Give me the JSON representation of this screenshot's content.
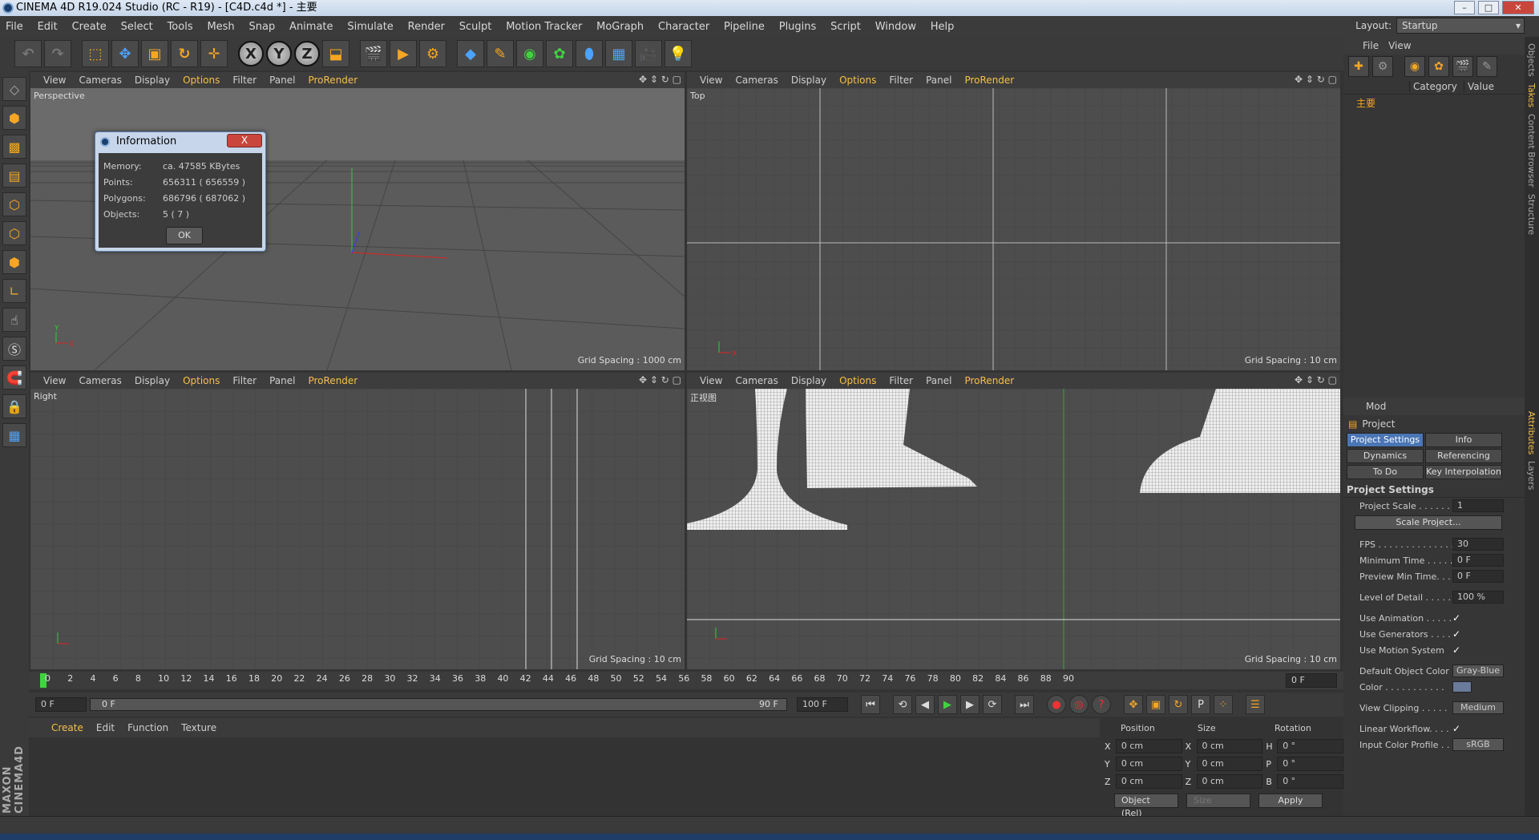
{
  "window": {
    "title": "CINEMA 4D R19.024 Studio (RC - R19) - [C4D.c4d *] - 主要"
  },
  "menu": [
    "File",
    "Edit",
    "Create",
    "Select",
    "Tools",
    "Mesh",
    "Snap",
    "Animate",
    "Simulate",
    "Render",
    "Sculpt",
    "Motion Tracker",
    "MoGraph",
    "Character",
    "Pipeline",
    "Plugins",
    "Script",
    "Window",
    "Help"
  ],
  "layout": {
    "label": "Layout:",
    "value": "Startup"
  },
  "viewport_menu": [
    "View",
    "Cameras",
    "Display",
    "Options",
    "Filter",
    "Panel",
    "ProRender"
  ],
  "viewports": [
    {
      "name": "Perspective",
      "grid": "Grid Spacing : 1000 cm"
    },
    {
      "name": "Top",
      "grid": "Grid Spacing : 10 cm"
    },
    {
      "name": "Right",
      "grid": "Grid Spacing : 10 cm"
    },
    {
      "name": "正视图",
      "grid": "Grid Spacing : 10 cm"
    }
  ],
  "info_dialog": {
    "title": "Information",
    "close": "X",
    "rows": [
      {
        "k": "Memory:",
        "v": "ca. 47585 KBytes"
      },
      {
        "k": "Points:",
        "v": "656311 ( 656559 )"
      },
      {
        "k": "Polygons:",
        "v": "686796 ( 687062 )"
      },
      {
        "k": "Objects:",
        "v": "5 ( 7 )"
      }
    ],
    "ok": "OK"
  },
  "timeline": {
    "ticks": [
      "0",
      "2",
      "4",
      "6",
      "8",
      "10",
      "12",
      "14",
      "16",
      "18",
      "20",
      "22",
      "24",
      "26",
      "28",
      "30",
      "32",
      "34",
      "36",
      "38",
      "40",
      "42",
      "44",
      "46",
      "48",
      "50",
      "52",
      "54",
      "56",
      "58",
      "60",
      "62",
      "64",
      "66",
      "68",
      "70",
      "72",
      "74",
      "76",
      "78",
      "80",
      "82",
      "84",
      "86",
      "88",
      "90"
    ],
    "current_frame": "0 F"
  },
  "transport": {
    "start": "0 F",
    "range_start": "0 F",
    "range_end": "90 F",
    "end": "100 F"
  },
  "material_manager": {
    "menu": [
      "Create",
      "Edit",
      "Function",
      "Texture"
    ]
  },
  "coords": {
    "headers": [
      "Position",
      "Size",
      "Rotation"
    ],
    "rows": [
      {
        "a": "X",
        "p": "0 cm",
        "b": "X",
        "s": "0 cm",
        "c": "H",
        "r": "0 °"
      },
      {
        "a": "Y",
        "p": "0 cm",
        "b": "Y",
        "s": "0 cm",
        "c": "P",
        "r": "0 °"
      },
      {
        "a": "Z",
        "p": "0 cm",
        "b": "Z",
        "s": "0 cm",
        "c": "B",
        "r": "0 °"
      }
    ],
    "mode": "Object (Rel)",
    "size_mode": "Size",
    "apply": "Apply"
  },
  "object_manager": {
    "menu": [
      "File",
      "View"
    ],
    "columns": [
      "Category",
      "Value"
    ],
    "tree_item": "主要"
  },
  "attributes": {
    "mode": "Mod",
    "title": "Project",
    "tabs": [
      "Project Settings",
      "Info",
      "Dynamics",
      "Referencing",
      "To Do",
      "Key Interpolation"
    ],
    "section": "Project Settings",
    "project_scale": {
      "label": "Project Scale . . . . . .",
      "value": "1"
    },
    "scale_button": "Scale Project...",
    "fps": {
      "label": "FPS . . . . . . . . . . . . . . .",
      "value": "30"
    },
    "min_time": {
      "label": "Minimum Time . . . . .",
      "value": "0 F"
    },
    "preview_min": {
      "label": "Preview Min Time. . .",
      "value": "0 F"
    },
    "lod": {
      "label": "Level of Detail . . . . .",
      "value": "100 %"
    },
    "use_animation": {
      "label": "Use Animation . . . . .",
      "value": "✓"
    },
    "use_generators": {
      "label": "Use Generators . . . .",
      "value": "✓"
    },
    "use_motion": {
      "label": "Use Motion System",
      "value": "✓"
    },
    "default_color": {
      "label": "Default Object Color",
      "value": "Gray-Blue"
    },
    "color": {
      "label": "Color . . . . . . . . . . ."
    },
    "view_clipping": {
      "label": "View Clipping . . . . .",
      "value": "Medium"
    },
    "linear_workflow": {
      "label": "Linear Workflow. . . .",
      "value": "✓"
    },
    "input_profile": {
      "label": "Input Color Profile . .",
      "value": "sRGB"
    }
  },
  "side_tabs": [
    "Objects",
    "Takes",
    "Content Browser",
    "Structure",
    "Attributes",
    "Layers"
  ],
  "colors": {
    "accent": "#f5c04a",
    "tab_active": "#4a76b5",
    "play": "#3fd43f"
  }
}
